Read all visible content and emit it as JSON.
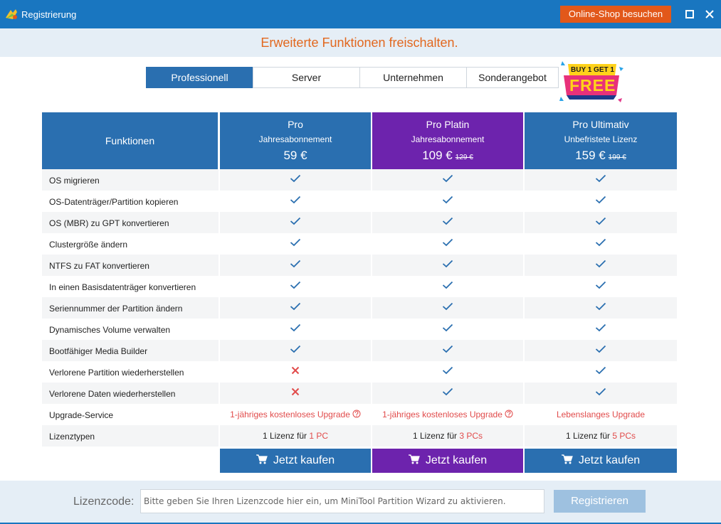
{
  "window": {
    "title": "Registrierung",
    "shop_button": "Online-Shop besuchen",
    "accent": "#1976c0"
  },
  "banner": {
    "text": "Erweiterte Funktionen freischalten."
  },
  "tabs": [
    {
      "label": "Professionell",
      "active": true
    },
    {
      "label": "Server",
      "active": false
    },
    {
      "label": "Unternehmen",
      "active": false
    },
    {
      "label": "Sonderangebot",
      "active": false
    }
  ],
  "promo": {
    "line1": "BUY 1 GET 1",
    "line2": "FREE"
  },
  "table": {
    "functions_header": "Funktionen",
    "plans": [
      {
        "name": "Pro",
        "subscription": "Jahresabonnement",
        "price": "59 €",
        "old_price": "",
        "color": "#2a6fb0"
      },
      {
        "name": "Pro Platin",
        "subscription": "Jahresabonnement",
        "price": "109 €",
        "old_price": "129 €",
        "color": "#6d23ad"
      },
      {
        "name": "Pro Ultimativ",
        "subscription": "Unbefristete Lizenz",
        "price": "159 €",
        "old_price": "199 €",
        "color": "#2a6fb0"
      }
    ],
    "features": [
      {
        "label": "OS migrieren",
        "values": [
          "check",
          "check",
          "check"
        ]
      },
      {
        "label": "OS-Datenträger/Partition kopieren",
        "values": [
          "check",
          "check",
          "check"
        ]
      },
      {
        "label": "OS (MBR) zu GPT konvertieren",
        "values": [
          "check",
          "check",
          "check"
        ]
      },
      {
        "label": "Clustergröße ändern",
        "values": [
          "check",
          "check",
          "check"
        ]
      },
      {
        "label": "NTFS zu FAT konvertieren",
        "values": [
          "check",
          "check",
          "check"
        ]
      },
      {
        "label": "In einen Basisdatenträger konvertieren",
        "values": [
          "check",
          "check",
          "check"
        ]
      },
      {
        "label": "Seriennummer der Partition ändern",
        "values": [
          "check",
          "check",
          "check"
        ]
      },
      {
        "label": "Dynamisches Volume verwalten",
        "values": [
          "check",
          "check",
          "check"
        ]
      },
      {
        "label": "Bootfähiger Media Builder",
        "values": [
          "check",
          "check",
          "check"
        ]
      },
      {
        "label": "Verlorene Partition wiederherstellen",
        "values": [
          "cross",
          "check",
          "check"
        ]
      },
      {
        "label": "Verlorene Daten wiederherstellen",
        "values": [
          "cross",
          "check",
          "check"
        ]
      }
    ],
    "upgrade_label": "Upgrade-Service",
    "upgrade_values": [
      "1-jähriges kostenloses Upgrade",
      "1-jähriges kostenloses Upgrade",
      "Lebenslanges Upgrade"
    ],
    "license_label": "Lizenztypen",
    "license_prefix": "1 Lizenz für",
    "license_counts": [
      "1 PC",
      "3 PCs",
      "5 PCs"
    ],
    "buy_label": "Jetzt kaufen"
  },
  "footer": {
    "license_label": "Lizenzcode:",
    "license_placeholder": "Bitte geben Sie Ihren Lizenzcode hier ein, um MiniTool Partition Wizard zu aktivieren.",
    "register_button": "Registrieren"
  }
}
